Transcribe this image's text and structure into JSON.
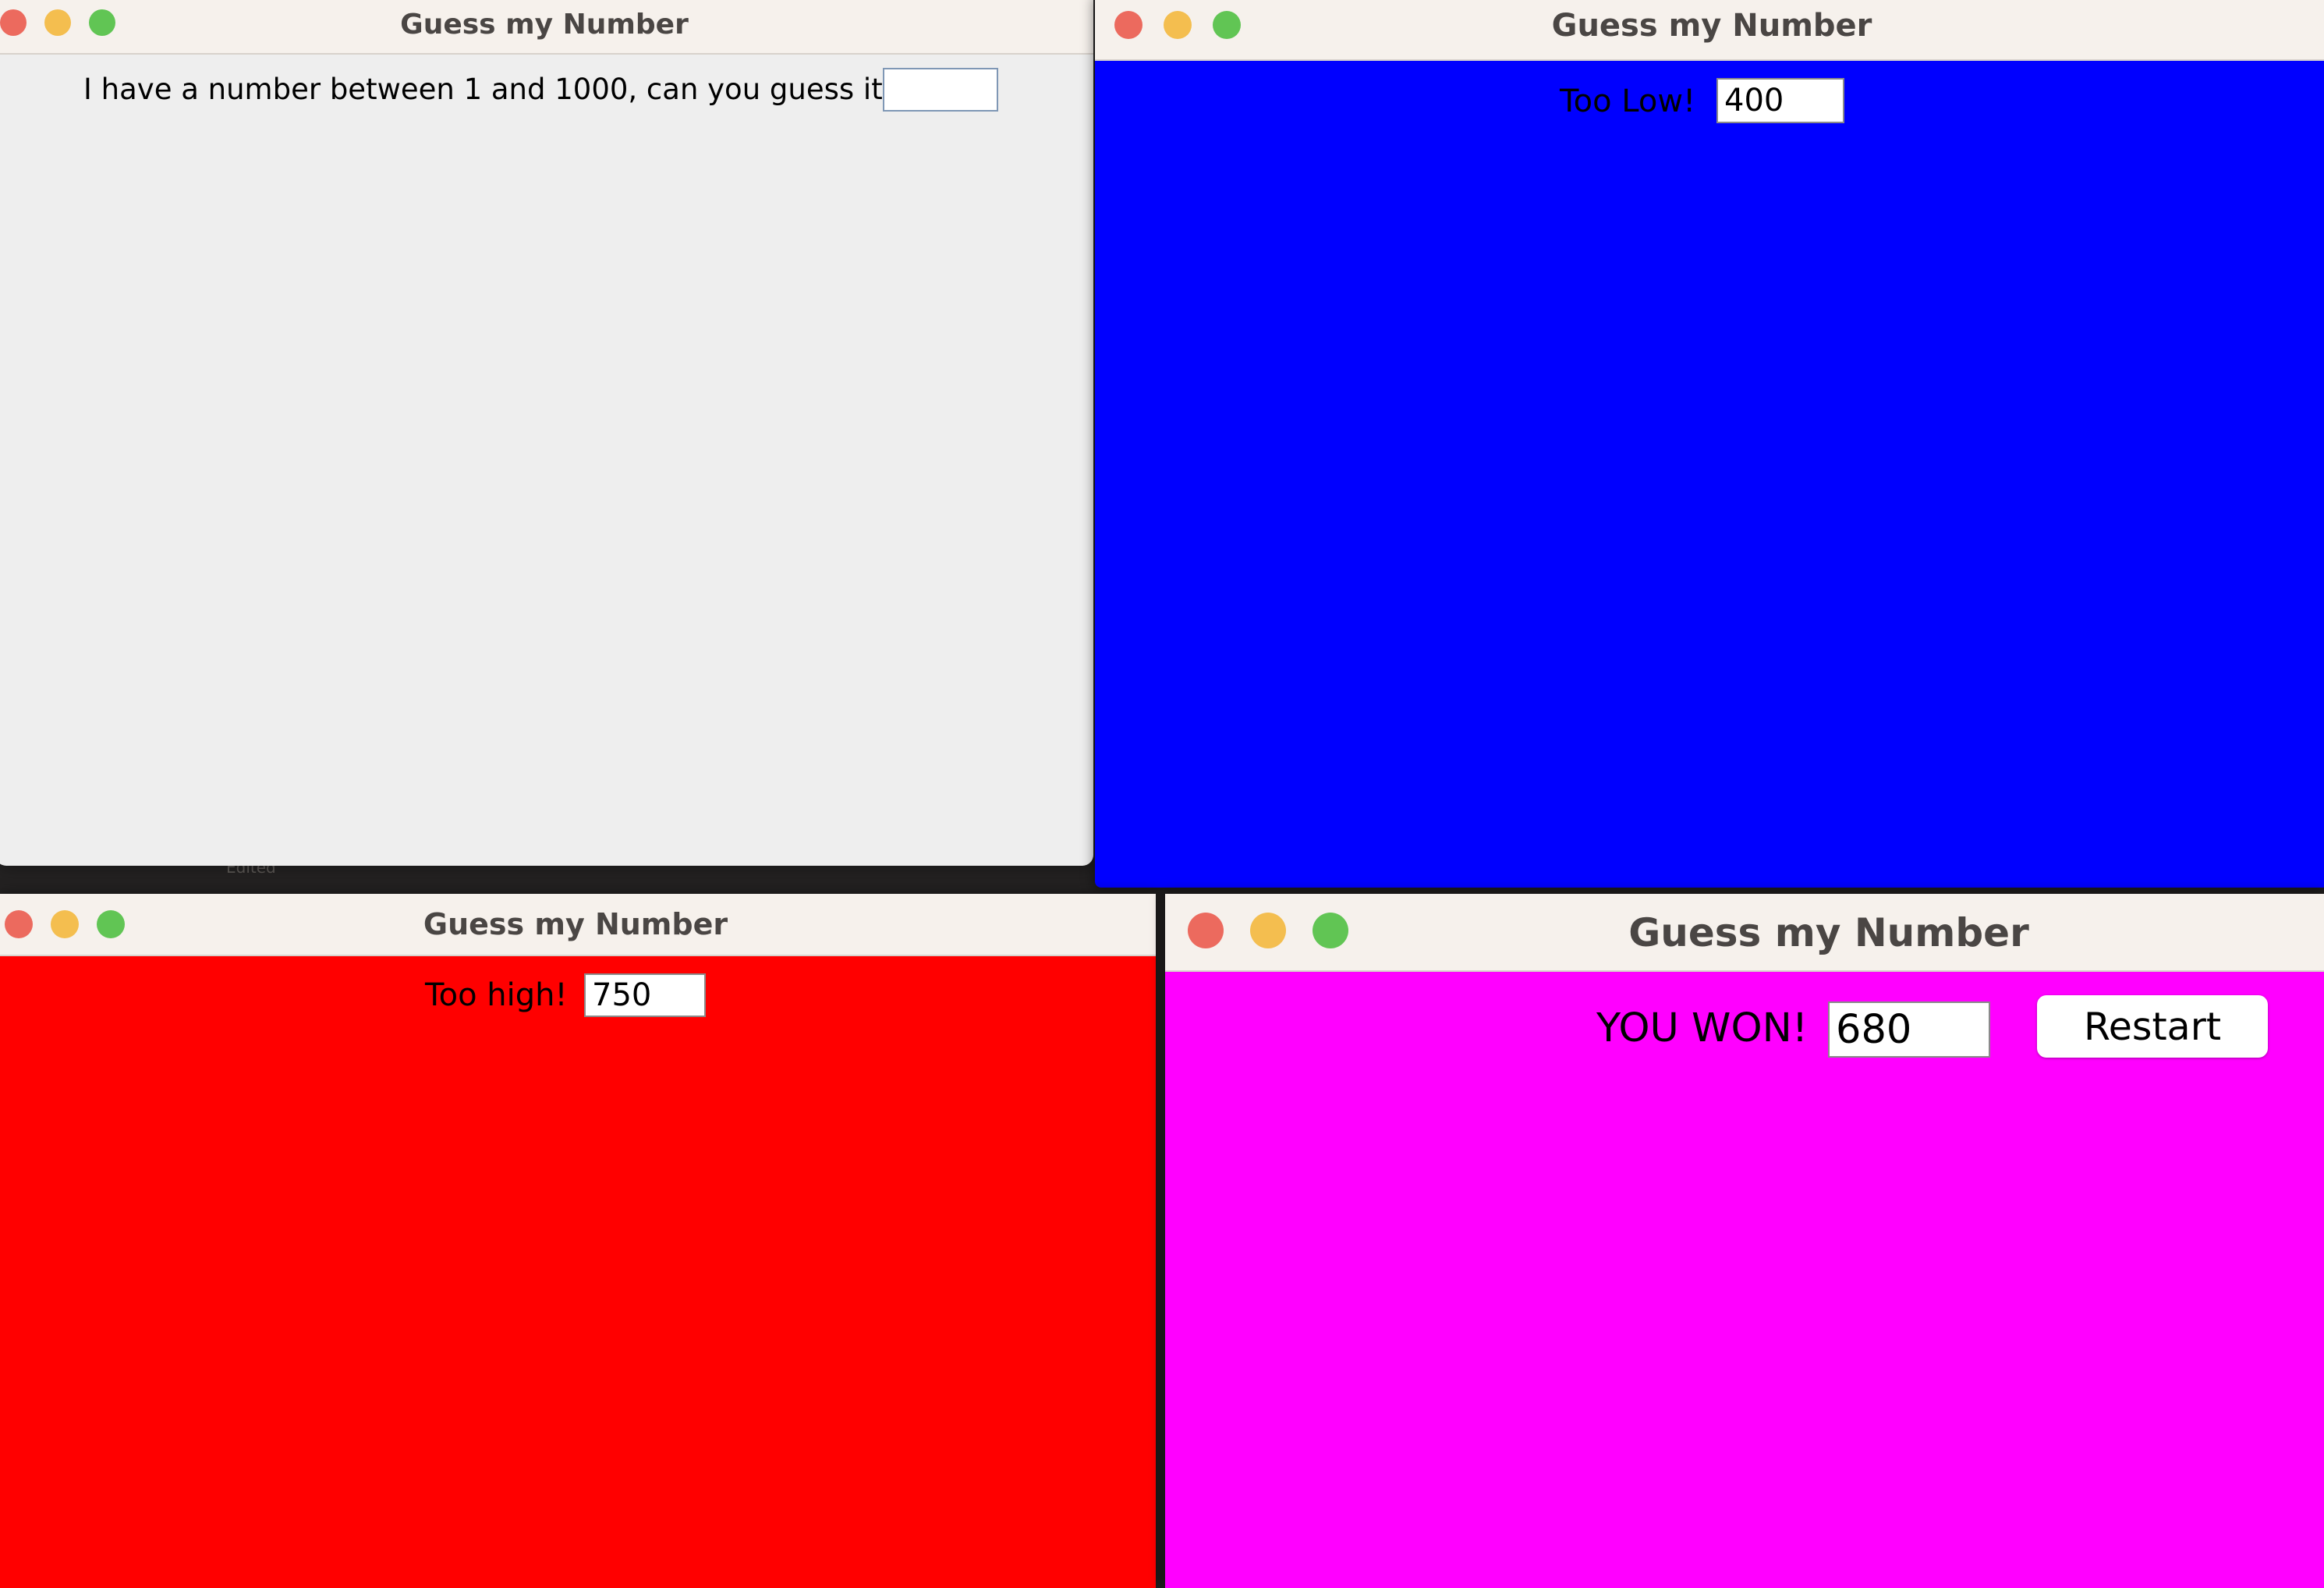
{
  "windows": [
    {
      "title": "Guess my Number",
      "background": "#eeeeee",
      "state": "initial",
      "prompt": "I have a number between 1 and 1000, can you guess it?",
      "guess_value": ""
    },
    {
      "title": "Guess my Number",
      "background": "#0000ff",
      "state": "too-low",
      "prompt": "Too Low!",
      "guess_value": "400"
    },
    {
      "title": "Guess my Number",
      "background": "#ff0000",
      "state": "too-high",
      "prompt": "Too high!",
      "guess_value": "750"
    },
    {
      "title": "Guess my Number",
      "background": "#ff00ff",
      "state": "won",
      "prompt": "YOU WON!",
      "guess_value": "680",
      "restart_label": "Restart"
    }
  ],
  "traffic_light_colors": {
    "close": "#ec6a5e",
    "minimize": "#f4be4f",
    "zoom": "#61c554"
  },
  "desktop_fragment_text": "Edited"
}
